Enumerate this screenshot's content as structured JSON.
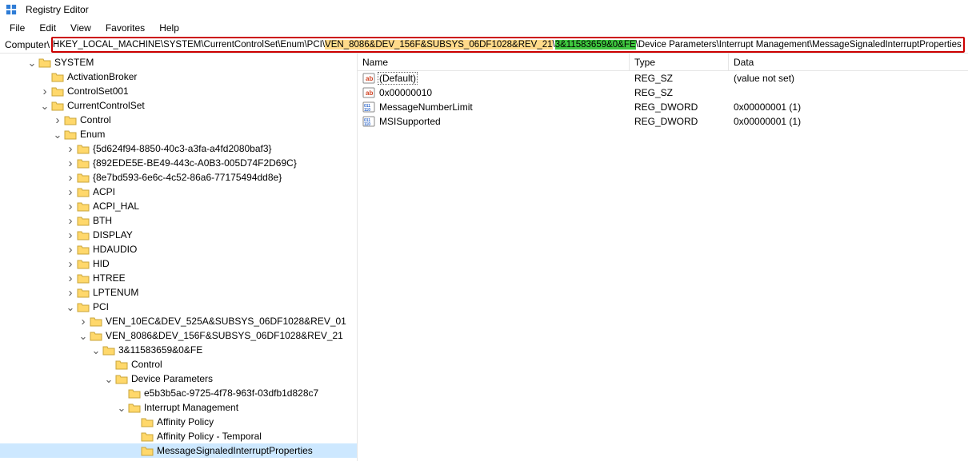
{
  "window": {
    "title": "Registry Editor"
  },
  "menu": {
    "file": "File",
    "edit": "Edit",
    "view": "View",
    "favorites": "Favorites",
    "help": "Help"
  },
  "address": {
    "label": "Computer\\",
    "seg1": "HKEY_LOCAL_MACHINE\\SYSTEM\\CurrentControlSet\\Enum\\PCI\\",
    "seg2": "VEN_8086&DEV_156F&SUBSYS_06DF1028&REV_21",
    "seg3": "\\",
    "seg4": "3&11583659&0&FE",
    "seg5": "\\Device Parameters\\Interrupt Management\\MessageSignaledInterruptProperties"
  },
  "tree": {
    "system": "SYSTEM",
    "activation_broker": "ActivationBroker",
    "controlset001": "ControlSet001",
    "currentcontrolset": "CurrentControlSet",
    "control": "Control",
    "enum": "Enum",
    "guid1": "{5d624f94-8850-40c3-a3fa-a4fd2080baf3}",
    "guid2": "{892EDE5E-BE49-443c-A0B3-005D74F2D69C}",
    "guid3": "{8e7bd593-6e6c-4c52-86a6-77175494dd8e}",
    "acpi": "ACPI",
    "acpi_hal": "ACPI_HAL",
    "bth": "BTH",
    "display": "DISPLAY",
    "hdaudio": "HDAUDIO",
    "hid": "HID",
    "htree": "HTREE",
    "lptenum": "LPTENUM",
    "pci": "PCI",
    "ven10ec": "VEN_10EC&DEV_525A&SUBSYS_06DF1028&REV_01",
    "ven8086": "VEN_8086&DEV_156F&SUBSYS_06DF1028&REV_21",
    "instance": "3&11583659&0&FE",
    "control2": "Control",
    "device_params": "Device Parameters",
    "devguid": "e5b3b5ac-9725-4f78-963f-03dfb1d828c7",
    "interrupt_mgmt": "Interrupt Management",
    "affinity_policy": "Affinity Policy",
    "affinity_policy_t": "Affinity Policy - Temporal",
    "msip": "MessageSignaledInterruptProperties"
  },
  "list": {
    "headers": {
      "name": "Name",
      "type": "Type",
      "data": "Data"
    },
    "rows": [
      {
        "icon": "str",
        "name": "(Default)",
        "type": "REG_SZ",
        "data": "(value not set)",
        "sel": true
      },
      {
        "icon": "str",
        "name": "0x00000010",
        "type": "REG_SZ",
        "data": "",
        "sel": false
      },
      {
        "icon": "bin",
        "name": "MessageNumberLimit",
        "type": "REG_DWORD",
        "data": "0x00000001 (1)",
        "sel": false
      },
      {
        "icon": "bin",
        "name": "MSISupported",
        "type": "REG_DWORD",
        "data": "0x00000001 (1)",
        "sel": false
      }
    ]
  }
}
